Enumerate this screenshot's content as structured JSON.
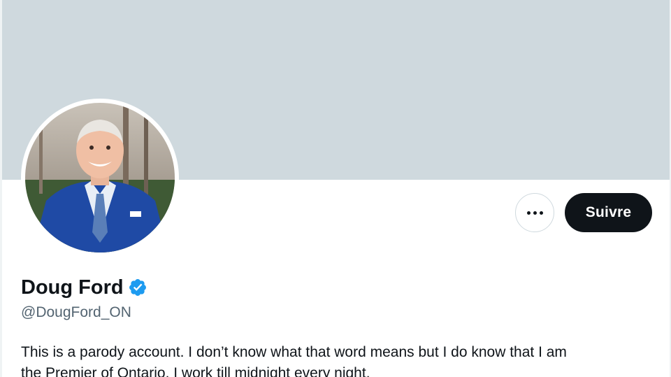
{
  "profile": {
    "display_name": "Doug Ford",
    "handle": "@DougFord_ON",
    "verified": true,
    "bio_line1": "This is a parody account. I don’t know what that word means but I do know that I am",
    "bio_line2": "the Premier of Ontario. I work till midnight every night."
  },
  "actions": {
    "more_icon": "more-horizontal-icon",
    "follow_label": "Suivre"
  },
  "colors": {
    "banner": "#cfd9de",
    "verified_badge": "#1d9bf0",
    "follow_button_bg": "#0f1419",
    "text_primary": "#0f1419",
    "text_secondary": "#536471"
  }
}
